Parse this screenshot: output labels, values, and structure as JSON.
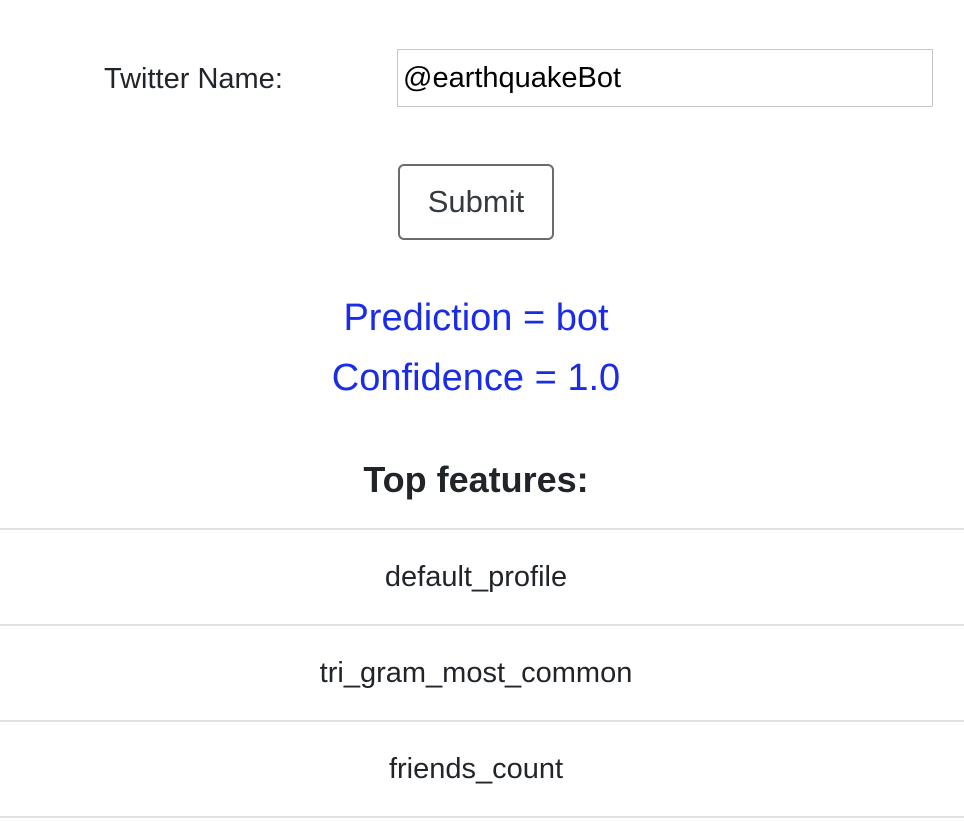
{
  "form": {
    "name_label": "Twitter Name:",
    "name_value": "@earthquakeBot",
    "submit_label": "Submit"
  },
  "result": {
    "prediction": "Prediction = bot",
    "confidence": "Confidence = 1.0",
    "color": "#1a2ce8"
  },
  "features": {
    "heading": "Top features:",
    "items": [
      "default_profile",
      "tri_gram_most_common",
      "friends_count"
    ]
  }
}
